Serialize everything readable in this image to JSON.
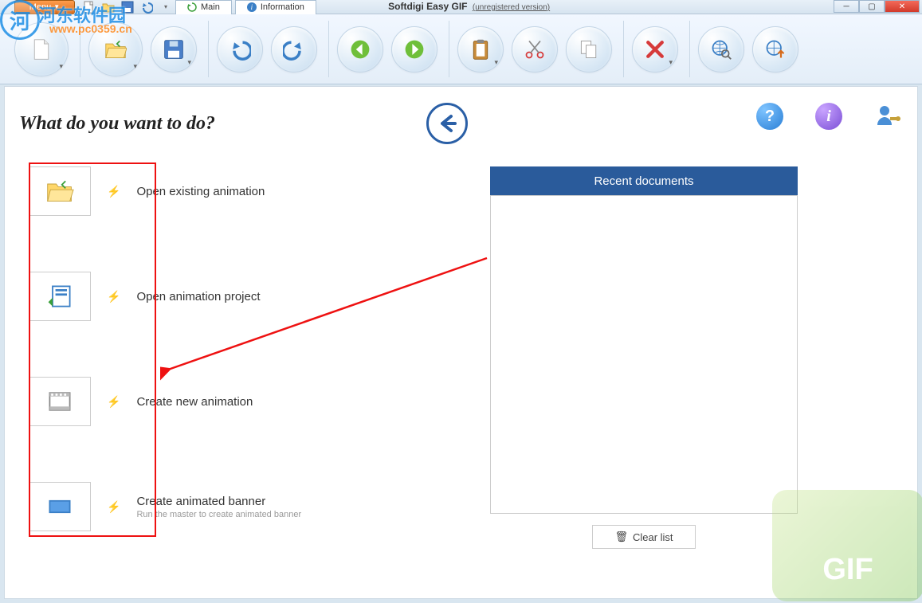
{
  "titlebar": {
    "menu_label": "Menu",
    "tabs": {
      "main": "Main",
      "information": "Information"
    },
    "app_name": "Softdigi Easy GIF",
    "unregistered": "(unregistered version)"
  },
  "main": {
    "heading": "What do you want to do?",
    "actions": {
      "open_existing": "Open existing animation",
      "open_project": "Open animation project",
      "create_new": "Create new animation",
      "create_banner": "Create animated banner",
      "create_banner_sub": "Run the master to create animated banner"
    },
    "recent": {
      "header": "Recent documents",
      "clear_label": "Clear list"
    }
  },
  "watermark": {
    "gif_text": "GIF",
    "site_name": "河东软件园",
    "site_url": "www.pc0359.cn"
  }
}
